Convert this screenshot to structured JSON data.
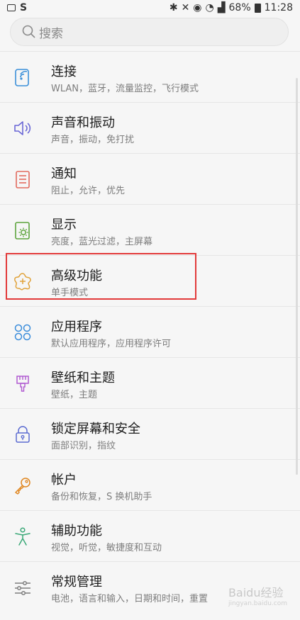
{
  "status_bar": {
    "battery": "68%",
    "time": "11:28"
  },
  "search": {
    "placeholder": "搜索"
  },
  "items": [
    {
      "title": "连接",
      "subtitle": "WLAN，蓝牙，流量监控，飞行模式",
      "icon": "connection-icon",
      "color": "#3a8fd9"
    },
    {
      "title": "声音和振动",
      "subtitle": "声音，振动，免打扰",
      "icon": "sound-icon",
      "color": "#6a67d6"
    },
    {
      "title": "通知",
      "subtitle": "阻止，允许，优先",
      "icon": "notification-icon",
      "color": "#e26b5e"
    },
    {
      "title": "显示",
      "subtitle": "亮度，蓝光过滤，主屏幕",
      "icon": "display-icon",
      "color": "#5ca33c"
    },
    {
      "title": "高级功能",
      "subtitle": "单手模式",
      "icon": "advanced-features-icon",
      "color": "#e0a23a"
    },
    {
      "title": "应用程序",
      "subtitle": "默认应用程序，应用程序许可",
      "icon": "apps-icon",
      "color": "#3b8ddb"
    },
    {
      "title": "壁纸和主题",
      "subtitle": "壁纸，主题",
      "icon": "wallpaper-icon",
      "color": "#b05ad1"
    },
    {
      "title": "锁定屏幕和安全",
      "subtitle": "面部识别，指纹",
      "icon": "lock-icon",
      "color": "#5b6bd1"
    },
    {
      "title": "帐户",
      "subtitle": "备份和恢复，S 换机助手",
      "icon": "key-icon",
      "color": "#e0861f"
    },
    {
      "title": "辅助功能",
      "subtitle": "视觉，听觉，敏捷度和互动",
      "icon": "accessibility-icon",
      "color": "#3aa877"
    },
    {
      "title": "常规管理",
      "subtitle": "电池，语言和输入，日期和时间，重置",
      "icon": "sliders-icon",
      "color": "#7d7d7d"
    }
  ],
  "watermark": {
    "text": "Baidu经验",
    "sub": "jingyan.baidu.com"
  },
  "colors": {
    "highlight": "#e23a3a",
    "background": "#f6f6f6"
  }
}
